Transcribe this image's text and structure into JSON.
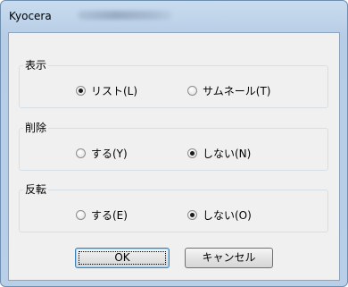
{
  "window": {
    "title": "Kyocera"
  },
  "groups": [
    {
      "label": "表示",
      "options": [
        {
          "label": "リスト(L)",
          "checked": true
        },
        {
          "label": "サムネール(T)",
          "checked": false
        }
      ]
    },
    {
      "label": "削除",
      "options": [
        {
          "label": "する(Y)",
          "checked": false
        },
        {
          "label": "しない(N)",
          "checked": true
        }
      ]
    },
    {
      "label": "反転",
      "options": [
        {
          "label": "する(E)",
          "checked": false
        },
        {
          "label": "しない(O)",
          "checked": true
        }
      ]
    }
  ],
  "buttons": {
    "ok": "OK",
    "cancel": "キャンセル"
  }
}
